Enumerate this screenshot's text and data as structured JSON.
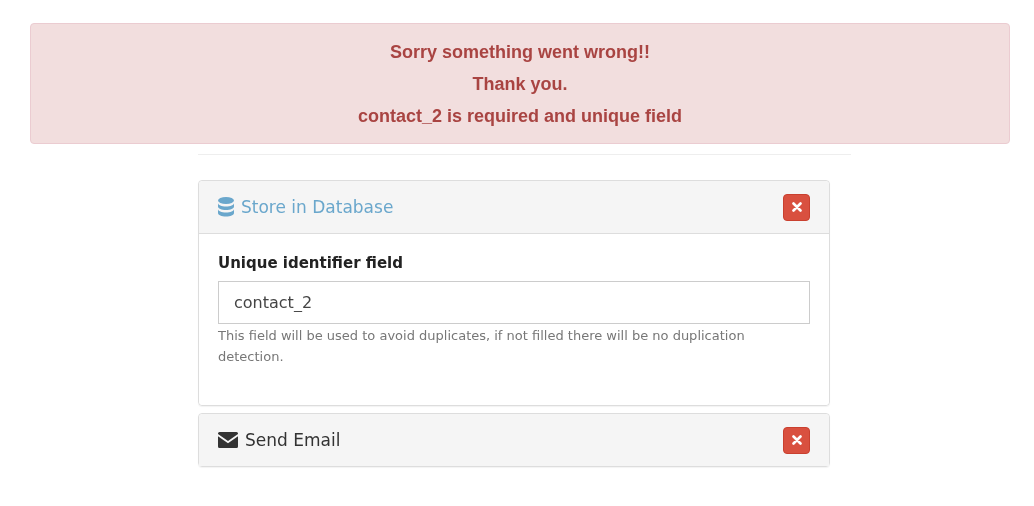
{
  "alert": {
    "lines": [
      "Sorry something went wrong!!",
      "Thank you.",
      "contact_2 is required and unique field"
    ]
  },
  "panels": [
    {
      "kind": "database",
      "title": "Store in Database",
      "expanded": true,
      "field": {
        "label": "Unique identifier field",
        "value": "contact_2",
        "help": "This field will be used to avoid duplicates, if not filled there will be no duplication detection."
      }
    },
    {
      "kind": "email",
      "title": "Send Email",
      "expanded": false
    }
  ]
}
